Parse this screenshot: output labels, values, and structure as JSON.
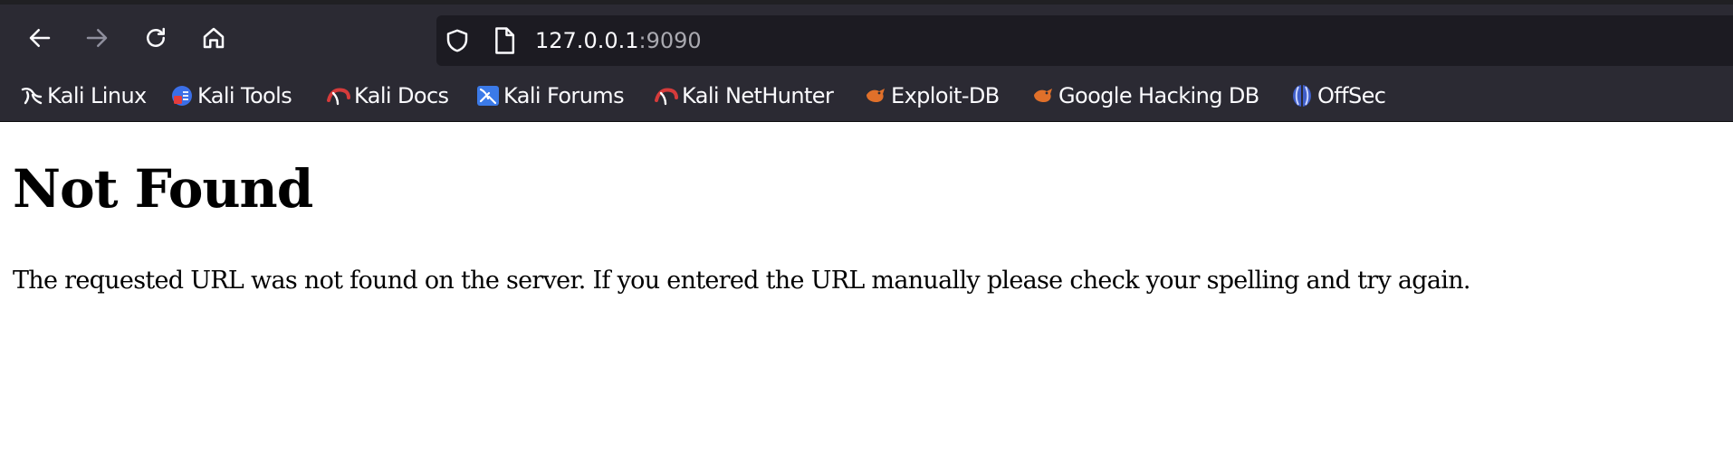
{
  "browser": {
    "url_host": "127.0.0.1",
    "url_port": ":9090",
    "icons": {
      "back": "back-arrow-icon",
      "forward": "forward-arrow-icon",
      "reload": "reload-icon",
      "home": "home-icon",
      "tracking_protection": "shield-icon",
      "page_info": "page-icon"
    },
    "colors": {
      "toolbar": "#2b2a33",
      "urlbar": "#1c1b22",
      "text": "#fbfbfe",
      "port_text": "#a9a9b0"
    }
  },
  "bookmarks": [
    {
      "label": "Kali Linux",
      "icon": "kali-dragon-icon"
    },
    {
      "label": "Kali Tools",
      "icon": "kali-tools-icon"
    },
    {
      "label": "Kali Docs",
      "icon": "kali-docs-icon"
    },
    {
      "label": "Kali Forums",
      "icon": "kali-forums-icon"
    },
    {
      "label": "Kali NetHunter",
      "icon": "kali-nethunter-icon"
    },
    {
      "label": "Exploit-DB",
      "icon": "exploit-db-icon"
    },
    {
      "label": "Google Hacking DB",
      "icon": "ghdb-icon"
    },
    {
      "label": "OffSec",
      "icon": "offsec-icon"
    }
  ],
  "page": {
    "title": "Not Found",
    "message": "The requested URL was not found on the server. If you entered the URL manually please check your spelling and try again."
  }
}
